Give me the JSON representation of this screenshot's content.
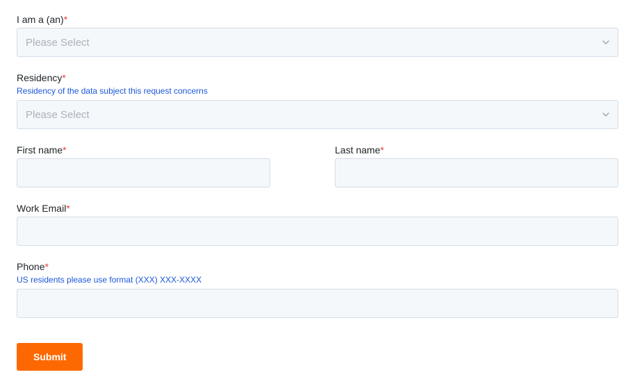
{
  "form": {
    "iam": {
      "label": "I am a (an)",
      "required": "*",
      "placeholder": "Please Select"
    },
    "residency": {
      "label": "Residency",
      "required": "*",
      "helper": "Residency of the data subject this request concerns",
      "placeholder": "Please Select"
    },
    "first_name": {
      "label": "First name",
      "required": "*"
    },
    "last_name": {
      "label": "Last name",
      "required": "*"
    },
    "work_email": {
      "label": "Work Email",
      "required": "*"
    },
    "phone": {
      "label": "Phone",
      "required": "*",
      "helper": "US residents please use format (XXX) XXX-XXXX"
    },
    "submit": {
      "label": "Submit"
    }
  }
}
